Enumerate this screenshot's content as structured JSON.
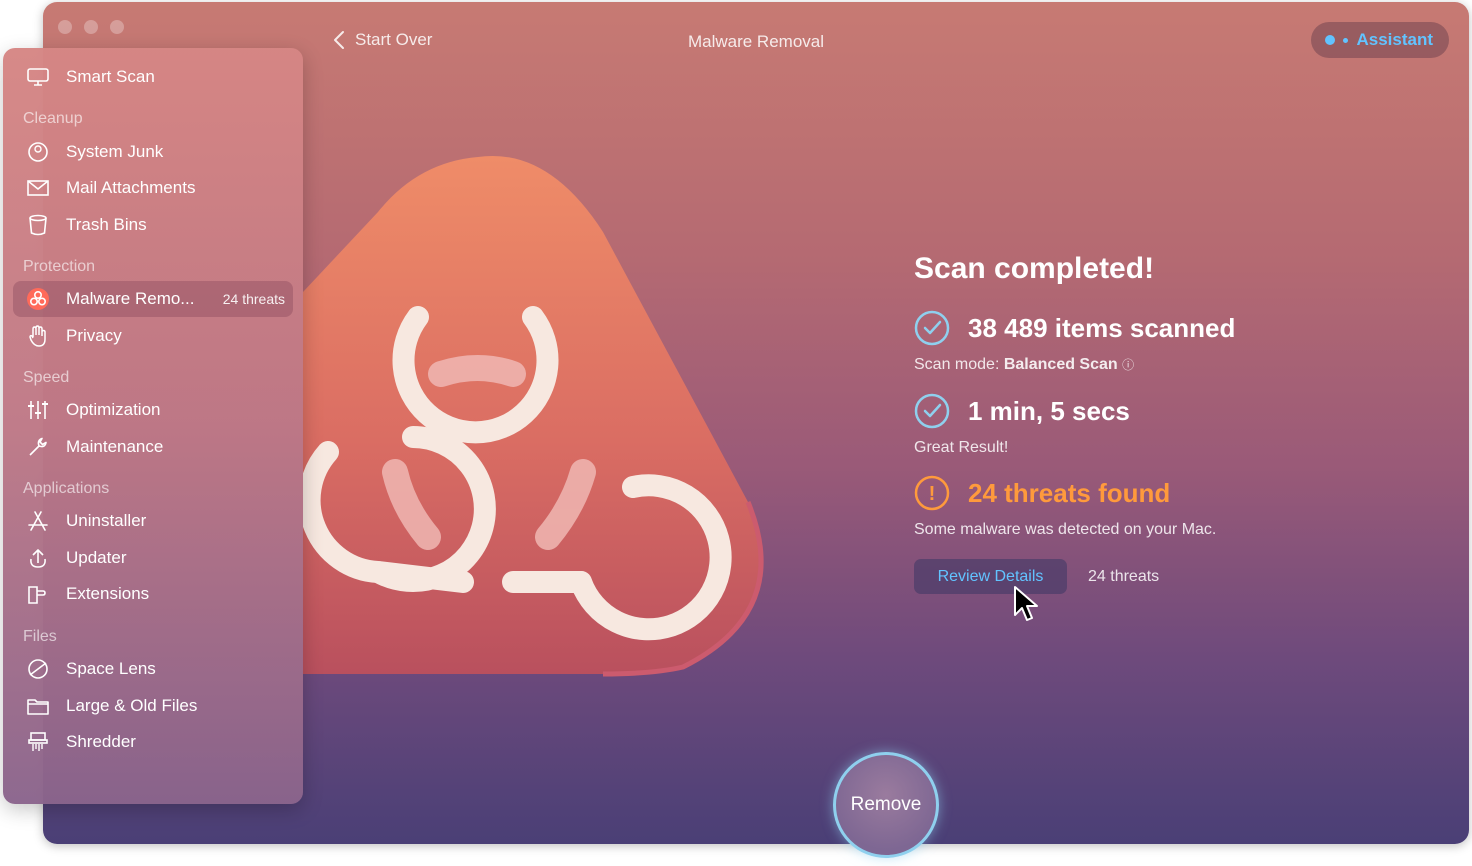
{
  "header": {
    "back_label": "Start Over",
    "title": "Malware Removal",
    "assistant_label": "Assistant"
  },
  "sidebar": {
    "smart_scan": "Smart Scan",
    "sections": {
      "cleanup": "Cleanup",
      "protection": "Protection",
      "speed": "Speed",
      "applications": "Applications",
      "files": "Files"
    },
    "items": {
      "system_junk": "System Junk",
      "mail_attachments": "Mail Attachments",
      "trash_bins": "Trash Bins",
      "malware_removal": "Malware Remo...",
      "malware_badge": "24 threats",
      "privacy": "Privacy",
      "optimization": "Optimization",
      "maintenance": "Maintenance",
      "uninstaller": "Uninstaller",
      "updater": "Updater",
      "extensions": "Extensions",
      "space_lens": "Space Lens",
      "large_old_files": "Large & Old Files",
      "shredder": "Shredder"
    }
  },
  "results": {
    "title": "Scan completed!",
    "items_scanned": "38 489 items scanned",
    "scan_mode_label": "Scan mode:",
    "scan_mode_value": "Balanced Scan",
    "duration": "1 min, 5 secs",
    "duration_sub": "Great Result!",
    "threats": "24 threats found",
    "threats_sub": "Some malware was detected on your Mac.",
    "review_button": "Review Details",
    "review_count": "24 threats"
  },
  "actions": {
    "remove_label": "Remove"
  },
  "colors": {
    "accent_blue": "#62c3ff",
    "threat_orange": "#ff9a3c"
  },
  "icons": {
    "info": "ⓘ",
    "warning": "!"
  }
}
